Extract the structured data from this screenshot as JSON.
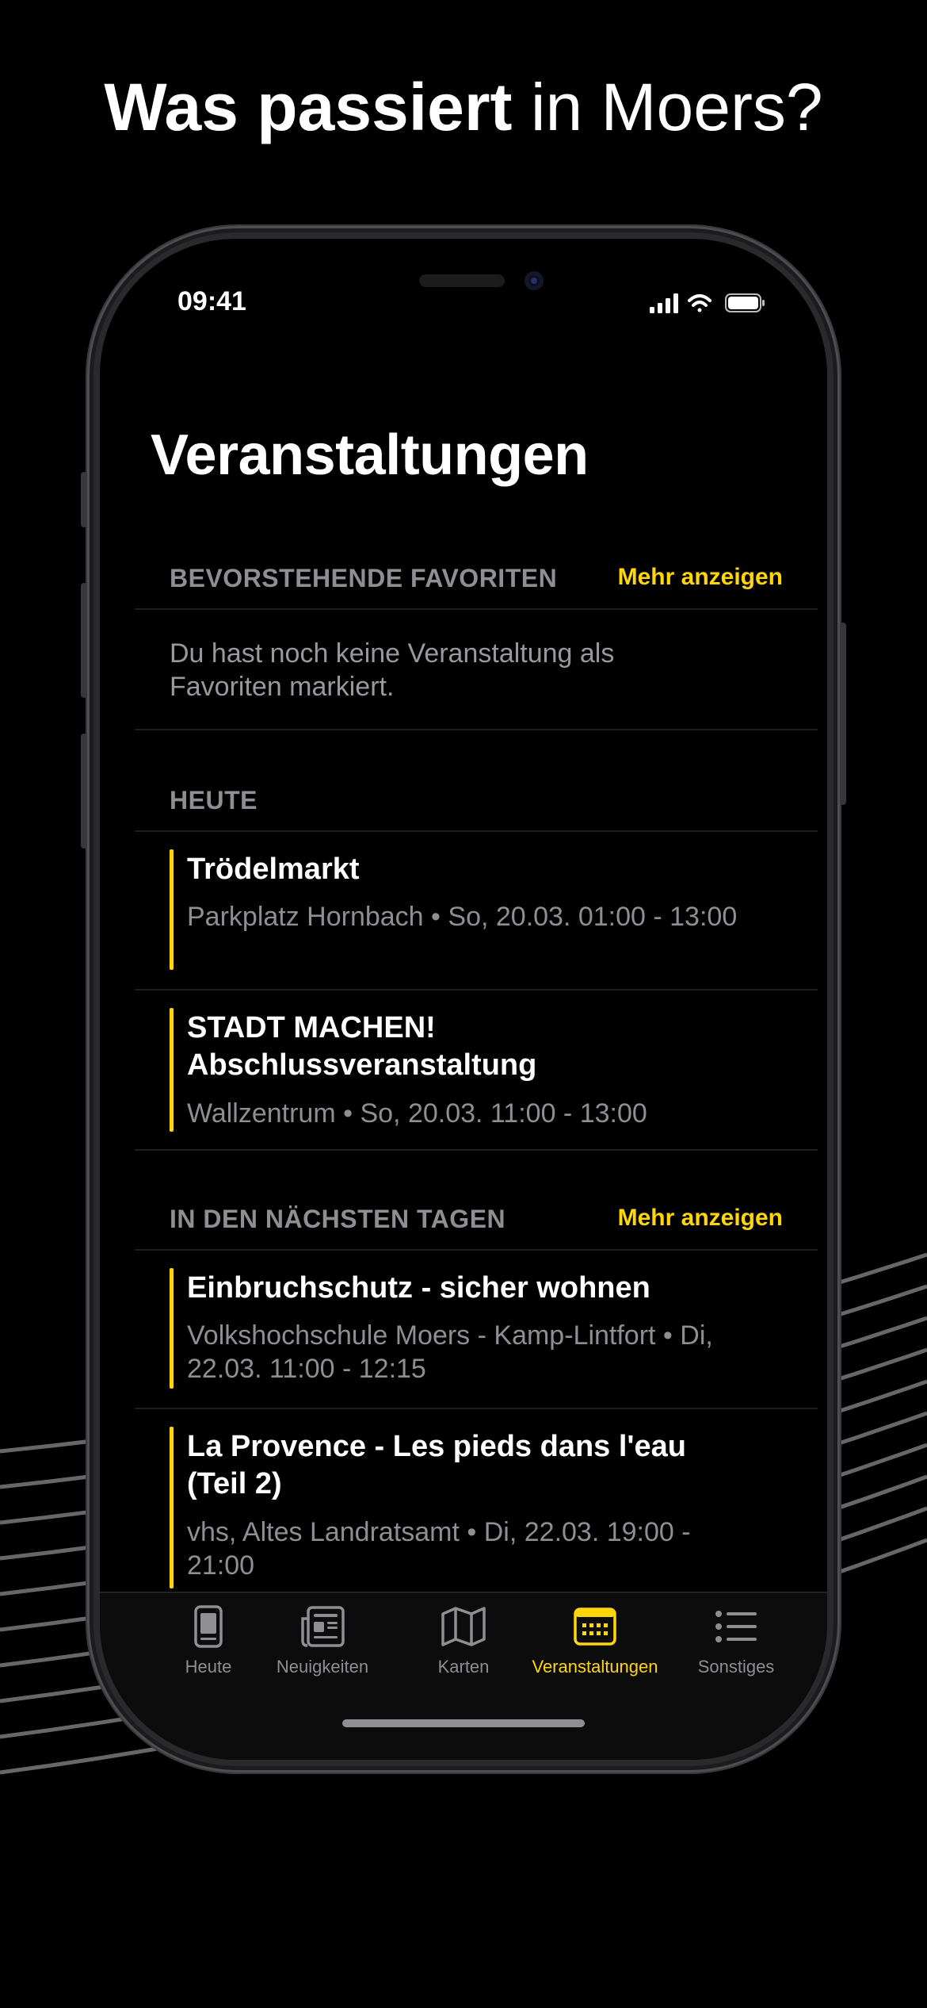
{
  "headline": {
    "bold": "Was passiert",
    "rest": " in Moers?"
  },
  "status_bar": {
    "time": "09:41"
  },
  "page_title": "Veranstaltungen",
  "favorites": {
    "header": "BEVORSTEHENDE FAVORITEN",
    "more": "Mehr anzeigen",
    "empty_text": "Du hast noch keine Veranstaltung als Favoriten markiert."
  },
  "today": {
    "header": "HEUTE",
    "events": [
      {
        "title": "Trödelmarkt",
        "meta": "Parkplatz Hornbach • So, 20.03. 01:00 - 13:00"
      },
      {
        "title": "STADT MACHEN! Abschlussveranstaltung",
        "meta": "Wallzentrum • So, 20.03. 11:00 - 13:00"
      }
    ]
  },
  "upcoming": {
    "header": "IN DEN NÄCHSTEN TAGEN",
    "more": "Mehr anzeigen",
    "events": [
      {
        "title": "Einbruchschutz - sicher wohnen",
        "meta": "Volkshochschule Moers - Kamp-Lintfort • Di, 22.03. 11:00 - 12:15"
      },
      {
        "title": "La Provence - Les pieds dans l'eau (Teil 2)",
        "meta": "vhs, Altes Landratsamt • Di, 22.03. 19:00 - 21:00"
      }
    ]
  },
  "tabs": [
    {
      "label": "Heute",
      "icon": "phone-document-icon"
    },
    {
      "label": "Neuigkeiten",
      "icon": "newspaper-icon"
    },
    {
      "label": "Karten",
      "icon": "map-icon"
    },
    {
      "label": "Veranstaltungen",
      "icon": "calendar-icon",
      "active": true
    },
    {
      "label": "Sonstiges",
      "icon": "list-icon"
    }
  ],
  "colors": {
    "accent": "#ffd60a",
    "background": "#000000",
    "secondary_text": "#8e8e93"
  }
}
